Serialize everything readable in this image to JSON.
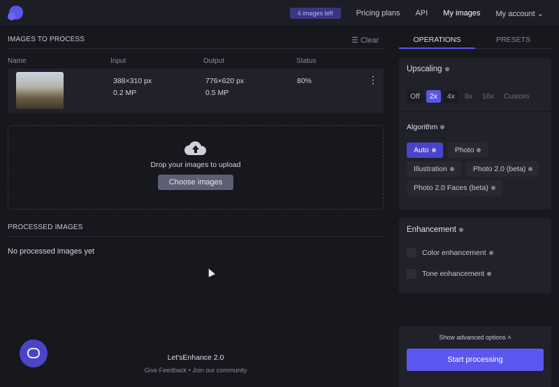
{
  "header": {
    "images_left": "4 images left",
    "nav": [
      "Pricing plans",
      "API",
      "My images",
      "My account"
    ]
  },
  "queue": {
    "title": "IMAGES TO PROCESS",
    "clear": "Clear",
    "columns": [
      "Name",
      "Input",
      "Output",
      "Status"
    ],
    "rows": [
      {
        "input_size": "388×310 px",
        "input_mp": "0.2 MP",
        "output_size": "776×620 px",
        "output_mp": "0.5 MP",
        "status": "80%"
      }
    ]
  },
  "upload": {
    "text": "Drop your images to upload",
    "button": "Choose images"
  },
  "processed": {
    "title": "PROCESSED IMAGES",
    "empty": "No processed images yet"
  },
  "footer": {
    "brand": "Let'sEnhance 2.0",
    "feedback": "Give Feedback",
    "separator": "•",
    "community": "Join our community"
  },
  "tabs": [
    "OPERATIONS",
    "PRESETS"
  ],
  "upscaling": {
    "title": "Upscaling",
    "options": [
      "Off",
      "2x",
      "4x",
      "8x",
      "16x",
      "Custom"
    ],
    "selected": "2x"
  },
  "algorithm": {
    "title": "Algorithm",
    "options": [
      "Auto",
      "Photo",
      "Illustration",
      "Photo 2.0 (beta)",
      "Photo 2.0 Faces (beta)"
    ],
    "selected": "Auto"
  },
  "enhancement": {
    "title": "Enhancement",
    "options": [
      {
        "label": "Color enhancement",
        "checked": false
      },
      {
        "label": "Tone enhancement",
        "checked": false
      }
    ]
  },
  "actions": {
    "advanced": "Show advanced options ˄",
    "start": "Start processing"
  },
  "colors": {
    "accent": "#5b57f0",
    "background": "#17171e",
    "panel": "#21212a"
  }
}
